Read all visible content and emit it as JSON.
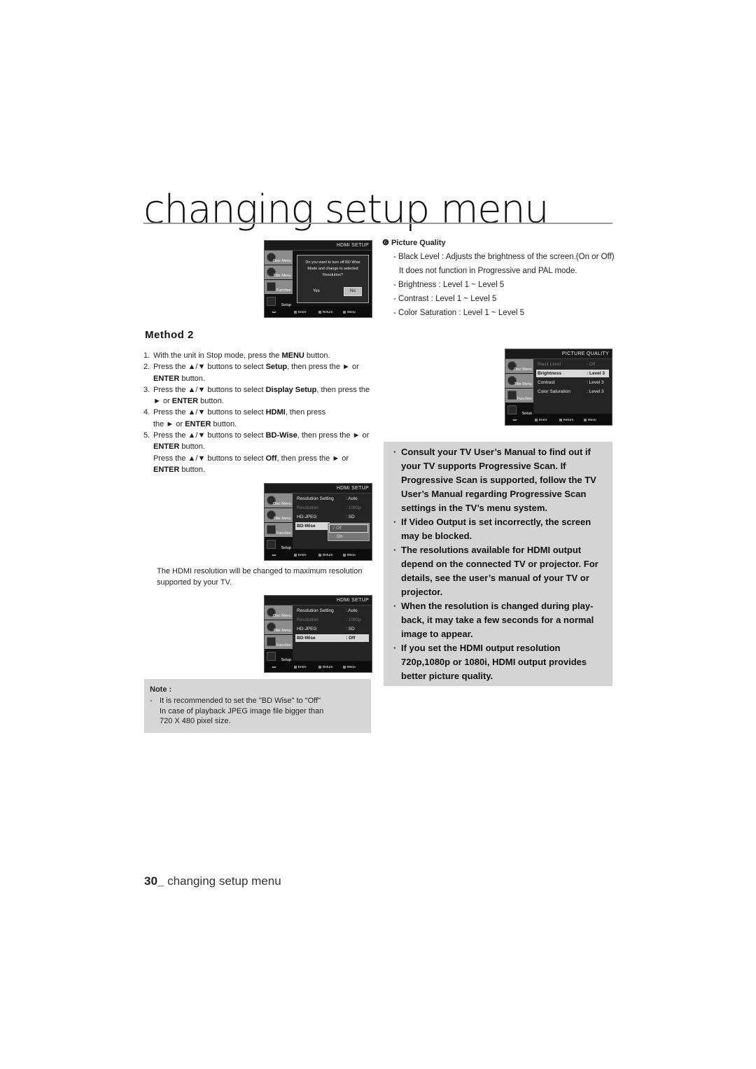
{
  "page": {
    "title": "changing setup menu",
    "footer_number": "30_",
    "footer_text": " changing setup menu"
  },
  "method2": {
    "heading": "Method 2",
    "steps": [
      {
        "num": "1.",
        "html": "With the unit in Stop mode, press the <b>MENU</b> button."
      },
      {
        "num": "2.",
        "html": "Press the ▲/▼ buttons to select <b>Setup</b>, then press the ► or <b>ENTER</b> button."
      },
      {
        "num": "3.",
        "html": "Press the ▲/▼ buttons to select <b>Display Setup</b>, then press the ► or <b>ENTER</b> button."
      },
      {
        "num": "4.",
        "html": "Press the ▲/▼ buttons to select <b>HDMI</b>, then press the ► or <b>ENTER</b> button."
      },
      {
        "num": "5.",
        "html": "Press the ▲/▼ buttons to select <b>BD-Wise</b>, then press the ► or <b>ENTER</b> button.<br>Press the ▲/▼ buttons to select <b>Off</b>, then press the ► or <b>ENTER</b> button."
      }
    ],
    "caption": "The HDMI resolution will be changed to maximum resolution supported by your TV."
  },
  "note": {
    "heading": "Note :",
    "dash": "-",
    "line1": "It is recommended to set the \"BD Wise\" to \"Off\"",
    "line2": "In case of playback JPEG image file bigger than",
    "line3": "720 X 480 pixel size."
  },
  "picture_quality": {
    "marker": "❻",
    "heading": "Picture Quality",
    "lines": [
      "- Black Level : Adjusts the brightness of the screen.(On or Off) It does not function in Progressive and PAL mode.",
      "- Brightness : Level 1 ~ Level 5",
      "- Contrast : Level 1 ~ Level 5",
      "- Color Saturation : Level 1 ~ Level 5"
    ]
  },
  "tips": [
    "Consult your TV User’s Manual to find out if your TV supports Progressive Scan. If Progressive Scan is supported, follow the TV User’s Manual regarding Progressive Scan settings in the TV’s menu system.",
    "If Video Output is set incorrectly, the screen may be blocked.",
    "The resolutions available for HDMI output depend on the connected TV or projector. For details, see the user’s manual of your TV or projector.",
    "When the resolution is changed during play-back, it may take a few seconds for a normal image to appear.",
    "If you set the HDMI output resolution 720p,1080p or 1080i, HDMI output provides better picture quality."
  ],
  "tip_bullet": "·",
  "osd_common": {
    "side": [
      "Disc Menu",
      "Title Menu",
      "Function",
      "Setup"
    ],
    "nav_icon": "◂▴▸",
    "enter": "Enter",
    "return": "Return",
    "menu": "Menu"
  },
  "osd_dialog": {
    "header": "HDMI SETUP",
    "message": "Do you want to turn off BD Wise Mode and change to selected Resolution?",
    "yes": "Yes",
    "no": "No"
  },
  "osd_hdmi_popup": {
    "header": "HDMI SETUP",
    "rows": [
      {
        "k": "Resolution Setting",
        "v": ": Auto"
      },
      {
        "k": "Resolution",
        "v": ": 1080p"
      },
      {
        "k": "HD-JPEG",
        "v": ": SD"
      },
      {
        "k": "BD-Wise",
        "v": ""
      }
    ],
    "popup_options": [
      "√  Off",
      "On"
    ]
  },
  "osd_hdmi_final": {
    "header": "HDMI SETUP",
    "rows": [
      {
        "k": "Resolution Setting",
        "v": ": Auto"
      },
      {
        "k": "Resolution",
        "v": ": 1080p"
      },
      {
        "k": "HD-JPEG",
        "v": ": SD"
      },
      {
        "k": "BD-Wise",
        "v": ": Off"
      }
    ]
  },
  "osd_picture": {
    "header": "PICTURE QUALITY",
    "rows": [
      {
        "k": "Black Level",
        "v": ": Off"
      },
      {
        "k": "Brightness",
        "v": ": Level 3"
      },
      {
        "k": "Contrast",
        "v": ": Level 3"
      },
      {
        "k": "Color Saturation",
        "v": ": Level 3"
      }
    ]
  }
}
